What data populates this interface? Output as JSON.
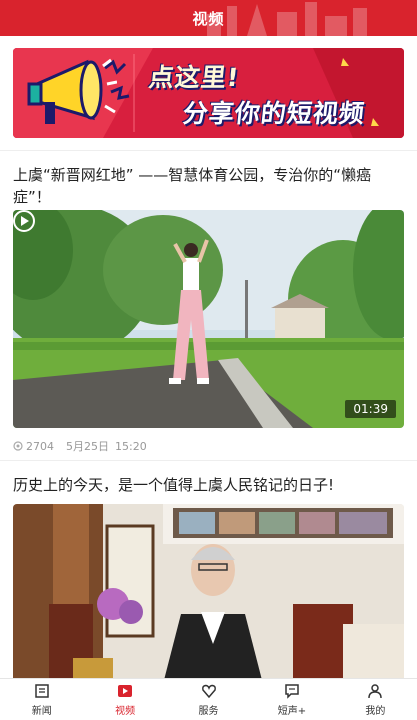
{
  "header": {
    "title": "视频",
    "accent_color": "#d9232d"
  },
  "banner": {
    "line1": "点这里!",
    "line2": "分享你的短视频",
    "icon": "megaphone-icon"
  },
  "articles": [
    {
      "title": "上虞“新晋网红地”  ——智慧体育公园，专治你的“懒癌症”！",
      "duration": "01:39",
      "views": "2704",
      "date": "5月25日",
      "time": "15:20"
    },
    {
      "title": "历史上的今天，是一个值得上虞人民铭记的日子!"
    }
  ],
  "tabbar": {
    "active": "视频",
    "items": [
      {
        "label": "新闻",
        "icon": "news-icon"
      },
      {
        "label": "视频",
        "icon": "video-play-icon"
      },
      {
        "label": "服务",
        "icon": "heart-service-icon"
      },
      {
        "label": "短声+",
        "icon": "message-icon"
      },
      {
        "label": "我的",
        "icon": "user-icon"
      }
    ]
  }
}
